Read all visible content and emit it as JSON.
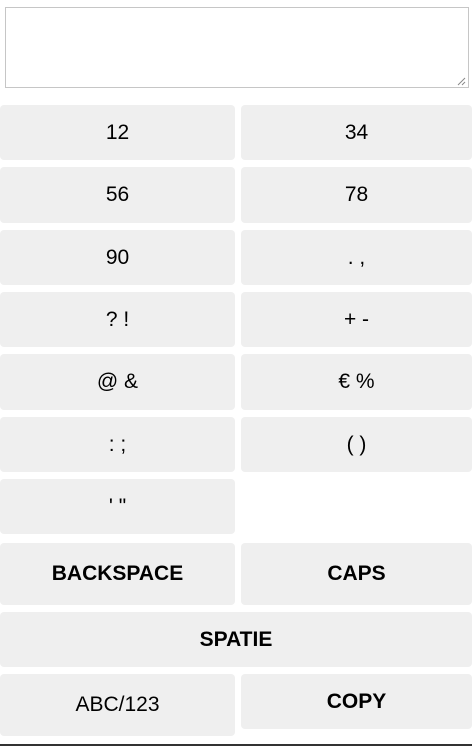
{
  "input": {
    "value": "",
    "placeholder": ""
  },
  "keys": {
    "k12": "12",
    "k34": "34",
    "k56": "56",
    "k78": "78",
    "k90": "90",
    "dot_comma": ". ,",
    "question_exclaim": "? !",
    "plus_minus": "+ -",
    "at_amp": "@ &",
    "euro_percent": "€ %",
    "colon_semicolon": ": ;",
    "parens": "( )",
    "quotes": "' \"",
    "backspace": "BACKSPACE",
    "caps": "CAPS",
    "space": "SPATIE",
    "mode": "ABC/123",
    "copy": "COPY"
  },
  "colors": {
    "key_background": "#efefef",
    "text": "#000000",
    "input_border": "#c6c6c6"
  }
}
